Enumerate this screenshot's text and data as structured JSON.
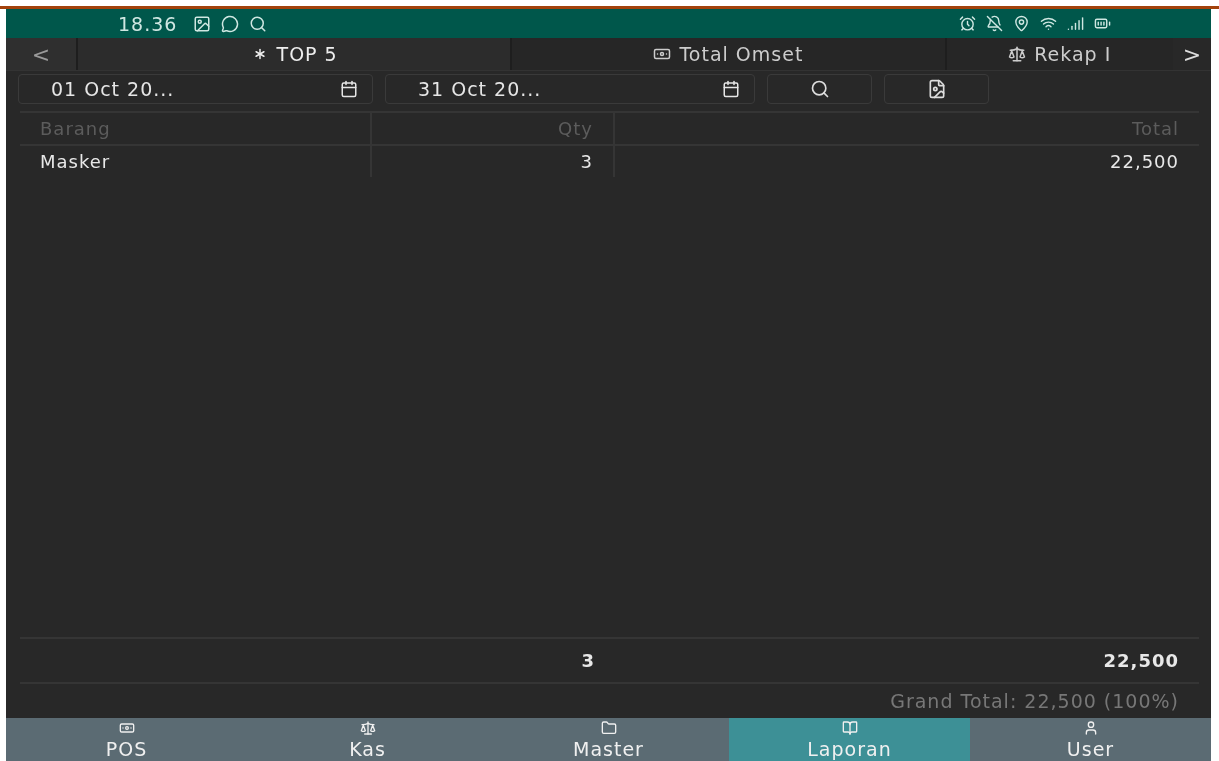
{
  "status_bar": {
    "time": "18.36"
  },
  "tabs": [
    {
      "label": "TOP 5",
      "selected": true
    },
    {
      "label": "Total Omset",
      "selected": false
    },
    {
      "label": "Rekap I",
      "selected": false
    }
  ],
  "tab_prev": "<",
  "tab_next": ">",
  "filters": {
    "date_from": "01 Oct 20...",
    "date_to": "31 Oct 20..."
  },
  "table": {
    "columns": [
      "Barang",
      "Qty",
      "Total"
    ],
    "rows": [
      [
        "Masker",
        "3",
        "22,500"
      ]
    ],
    "totals": {
      "qty": "3",
      "total": "22,500"
    },
    "grand_total": "Grand Total: 22,500 (100%)"
  },
  "bottom_nav": [
    {
      "label": "POS",
      "selected": false
    },
    {
      "label": "Kas",
      "selected": false
    },
    {
      "label": "Master",
      "selected": false
    },
    {
      "label": "Laporan",
      "selected": true
    },
    {
      "label": "User",
      "selected": false
    }
  ]
}
